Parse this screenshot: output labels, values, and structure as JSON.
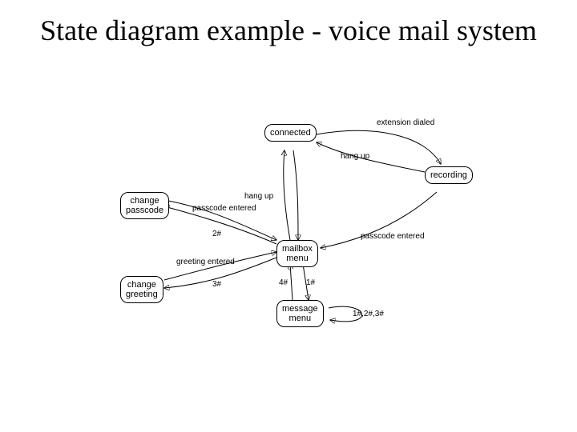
{
  "title": "State diagram example - voice mail system",
  "states": {
    "connected": "connected",
    "recording": "recording",
    "change_passcode": "change\npasscode",
    "mailbox_menu": "mailbox\nmenu",
    "change_greeting": "change\ngreeting",
    "message_menu": "message\nmenu"
  },
  "transitions": {
    "extension_dialed": "extension dialed",
    "hang_up_rec": "hang up",
    "hang_up_mailbox": "hang up",
    "passcode_entered_rec": "passcode entered",
    "passcode_entered_cp": "passcode entered",
    "two_hash": "2#",
    "greeting_entered": "greeting entered",
    "three_hash": "3#",
    "four_hash": "4#",
    "one_hash": "1#",
    "self_loop": "1#,2#,3#"
  }
}
